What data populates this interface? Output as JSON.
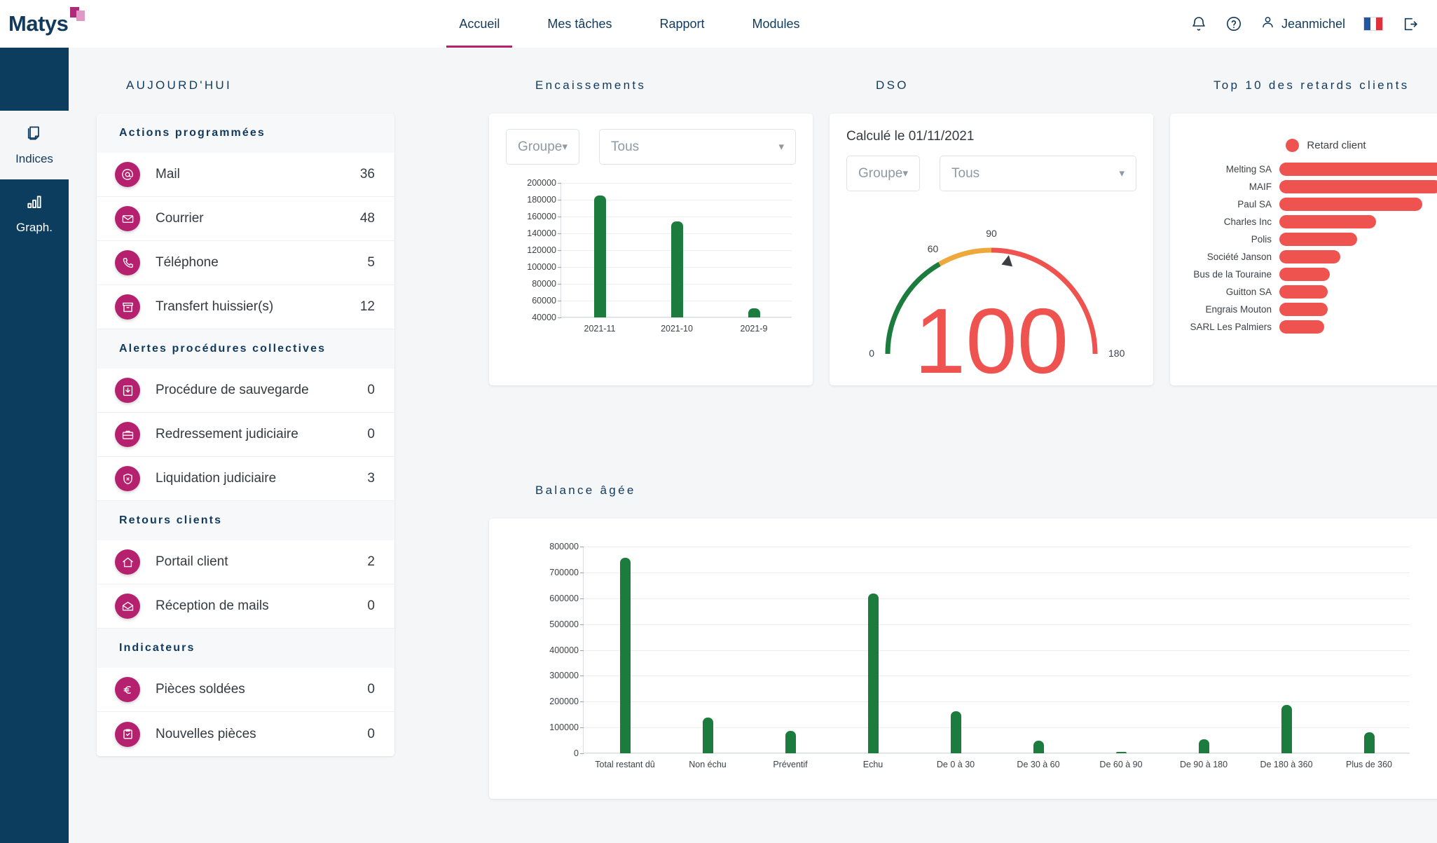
{
  "brand": {
    "name": "Matys",
    "accent": "#b6216f",
    "navy": "#0d3d5e"
  },
  "topnav": {
    "items": [
      {
        "label": "Accueil",
        "active": true
      },
      {
        "label": "Mes tâches",
        "active": false
      },
      {
        "label": "Rapport",
        "active": false
      },
      {
        "label": "Modules",
        "active": false
      }
    ],
    "user_name": "Jeanmichel",
    "icons": [
      "bell-icon",
      "help-icon",
      "user-icon",
      "flag-fr-icon",
      "logout-icon"
    ]
  },
  "rail": {
    "items": [
      {
        "label": "Indices",
        "icon": "note-icon",
        "active": true
      },
      {
        "label": "Graph.",
        "icon": "bar-chart-icon",
        "active": false
      }
    ]
  },
  "today": {
    "title": "Aujourd'hui",
    "groups": [
      {
        "heading": "Actions programmées",
        "rows": [
          {
            "icon": "at-icon",
            "label": "Mail",
            "count": "36"
          },
          {
            "icon": "envelope-icon",
            "label": "Courrier",
            "count": "48"
          },
          {
            "icon": "phone-icon",
            "label": "Téléphone",
            "count": "5"
          },
          {
            "icon": "archive-icon",
            "label": "Transfert huissier(s)",
            "count": "12"
          }
        ]
      },
      {
        "heading": "Alertes procédures collectives",
        "rows": [
          {
            "icon": "download-box-icon",
            "label": "Procédure de sauvegarde",
            "count": "0"
          },
          {
            "icon": "briefcase-icon",
            "label": "Redressement judiciaire",
            "count": "0"
          },
          {
            "icon": "shield-x-icon",
            "label": "Liquidation judiciaire",
            "count": "3"
          }
        ]
      },
      {
        "heading": "Retours clients",
        "rows": [
          {
            "icon": "home-icon",
            "label": "Portail client",
            "count": "2"
          },
          {
            "icon": "open-mail-icon",
            "label": "Réception de mails",
            "count": "0"
          }
        ]
      },
      {
        "heading": "Indicateurs",
        "rows": [
          {
            "icon": "euro-icon",
            "label": "Pièces soldées",
            "count": "0"
          },
          {
            "icon": "clipboard-check-icon",
            "label": "Nouvelles pièces",
            "count": "0"
          }
        ]
      }
    ]
  },
  "encaissements": {
    "title": "Encaissements",
    "filter_group_label": "Groupe",
    "filter_all_label": "Tous"
  },
  "dso": {
    "title": "DSO",
    "calculated_label": "Calculé le 01/11/2021",
    "filter_group_label": "Groupe",
    "filter_all_label": "Tous"
  },
  "top10": {
    "title": "Top 10 des retards clients"
  },
  "balance": {
    "title": "Balance âgée"
  },
  "chart_data": [
    {
      "id": "encaissements",
      "type": "bar",
      "title": "Encaissements",
      "categories": [
        "2021-11",
        "2021-10",
        "2021-9"
      ],
      "values": [
        185000,
        154000,
        51000
      ],
      "series": [
        {
          "name": "Encaissements",
          "values": [
            185000,
            154000,
            51000
          ]
        }
      ],
      "ylim": [
        40000,
        200000
      ],
      "yticks": [
        40000,
        60000,
        80000,
        100000,
        120000,
        140000,
        160000,
        180000,
        200000
      ],
      "ytick_labels": [
        "40000",
        "60000",
        "80000",
        "100000",
        "120000",
        "140000",
        "160000",
        "180000",
        "200000"
      ],
      "xlabel": "",
      "ylabel": "",
      "grid": true,
      "bar_color": "#1b7c3d",
      "legend": false
    },
    {
      "id": "dso",
      "type": "gauge",
      "title": "DSO",
      "value": 100,
      "min": 0,
      "max": 180,
      "tick_labels": [
        "0",
        "60",
        "90",
        "180"
      ],
      "ticks": [
        0,
        60,
        90,
        180
      ],
      "bands": [
        {
          "from": 0,
          "to": 60,
          "color": "#1b7c3d"
        },
        {
          "from": 60,
          "to": 90,
          "color": "#efa83c"
        },
        {
          "from": 90,
          "to": 180,
          "color": "#ef5350"
        }
      ],
      "value_color": "#ef5350",
      "needle": true,
      "annotation": "Calculé le 01/11/2021"
    },
    {
      "id": "top10",
      "type": "bar",
      "orientation": "horizontal",
      "title": "Top 10 des retards clients",
      "legend": [
        "Retard client"
      ],
      "legend_position": "top",
      "legend_color": "#ef5350",
      "categories": [
        "Melting SA",
        "MAIF",
        "Paul SA",
        "Charles Inc",
        "Polis",
        "Société Janson",
        "Bus de la Touraine",
        "Guitton SA",
        "Engrais Mouton",
        "SARL Les Palmiers"
      ],
      "values": [
        100,
        87,
        77,
        52,
        42,
        33,
        27,
        26,
        26,
        24
      ],
      "bar_color": "#ef5350",
      "grid": false
    },
    {
      "id": "balance_agee",
      "type": "bar",
      "title": "Balance âgée",
      "categories": [
        "Total restant dû",
        "Non échu",
        "Préventif",
        "Echu",
        "De 0 à 30",
        "De 30 à 60",
        "De 60 à 90",
        "De 90 à 180",
        "De 180 à 360",
        "Plus de 360"
      ],
      "values": [
        757000,
        137000,
        87000,
        618000,
        162000,
        50000,
        4000,
        55000,
        188000,
        82000
      ],
      "series": [
        {
          "name": "Balance âgée",
          "values": [
            757000,
            137000,
            87000,
            618000,
            162000,
            50000,
            4000,
            55000,
            188000,
            82000
          ]
        }
      ],
      "ylim": [
        0,
        800000
      ],
      "yticks": [
        0,
        100000,
        200000,
        300000,
        400000,
        500000,
        600000,
        700000,
        800000
      ],
      "ytick_labels": [
        "0",
        "100000",
        "200000",
        "300000",
        "400000",
        "500000",
        "600000",
        "700000",
        "800000"
      ],
      "xlabel": "",
      "ylabel": "",
      "grid": true,
      "bar_color": "#1b7c3d",
      "legend": false
    }
  ]
}
